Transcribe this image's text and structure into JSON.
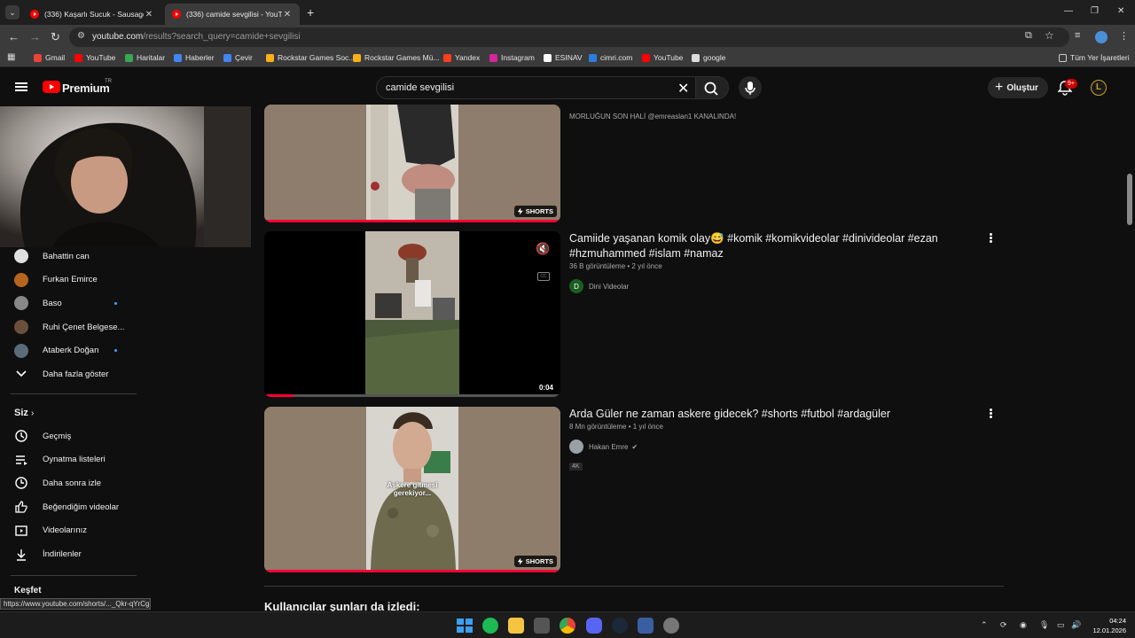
{
  "browser": {
    "tabs": [
      {
        "title": "(336) Kaşarlı Sucuk - Sausage W",
        "active": false
      },
      {
        "title": "(336) camide sevgilisi - YouTub",
        "active": true
      }
    ],
    "url_host": "youtube.com",
    "url_path": "/results?search_query=camide+sevgilisi",
    "bookmarks": [
      {
        "label": "Gmail",
        "color": "#ea4335"
      },
      {
        "label": "YouTube",
        "color": "#ff0000"
      },
      {
        "label": "Haritalar",
        "color": "#34a853"
      },
      {
        "label": "Haberler",
        "color": "#4285f4"
      },
      {
        "label": "Çevir",
        "color": "#4285f4"
      },
      {
        "label": "Rockstar Games Soc...",
        "color": "#fcaf17"
      },
      {
        "label": "Rockstar Games Mü...",
        "color": "#fcaf17"
      },
      {
        "label": "Yandex",
        "color": "#fc3f1d"
      },
      {
        "label": "Instagram",
        "color": "#d6249f"
      },
      {
        "label": "ESINAV",
        "color": "#ffffff"
      },
      {
        "label": "cimri.com",
        "color": "#2a7de1"
      },
      {
        "label": "YouTube",
        "color": "#ff0000"
      },
      {
        "label": "google",
        "color": "#dddddd"
      }
    ],
    "all_bookmarks": "Tüm Yer İşaretleri"
  },
  "header": {
    "brand": "Premium",
    "country": "TR",
    "search_value": "camide sevgilisi",
    "create_label": "Oluştur",
    "notifications": "9+",
    "avatar_letter": "L"
  },
  "sidebar": {
    "subscriptions": [
      {
        "name": "Bahattin can",
        "dot": false,
        "color": "#e0e0e0"
      },
      {
        "name": "Furkan Emirce",
        "dot": false,
        "color": "#b5651d"
      },
      {
        "name": "Baso",
        "dot": true,
        "color": "#888888"
      },
      {
        "name": "Ruhi Çenet Belgese...",
        "dot": false,
        "color": "#6b4f3a"
      },
      {
        "name": "Ataberk Doğan",
        "dot": true,
        "color": "#5a6b7a"
      }
    ],
    "show_more": "Daha fazla göster",
    "you_heading": "Siz",
    "you_items": [
      "Geçmiş",
      "Oynatma listeleri",
      "Daha sonra izle",
      "Beğendiğim videolar",
      "Videolarınız",
      "İndirilenler"
    ],
    "explore_heading": "Keşfet",
    "status_url": "https://www.youtube.com/shorts/..._Qkr-qYrCgI"
  },
  "results": [
    {
      "desc": "MORLUĞUN SON HALİ @emreaslan1 KANALINDA!",
      "badge": "SHORTS"
    },
    {
      "title": "Camiide yaşanan komik olay😅 #komik #komikvideolar #dinivideolar #ezan #hzmuhammed #islam #namaz",
      "views": "36 B görüntüleme",
      "age": "2 yıl önce",
      "channel": "Dini Videolar",
      "channel_initial": "D",
      "duration": "0:04",
      "progress": 0.1
    },
    {
      "title": "Arda Güler ne zaman askere gidecek? #shorts #futbol #ardagüler",
      "views": "8 Mn görüntüleme",
      "age": "1 yıl önce",
      "channel": "Hakan Emre",
      "verified": true,
      "quality": "4K",
      "badge": "SHORTS",
      "caption": "Askere gitmesi gerekiyor..."
    }
  ],
  "more_heading": "Kullanıcılar şunları da izledi:",
  "clock": {
    "time": "04:24",
    "date": "12.01.2026"
  }
}
